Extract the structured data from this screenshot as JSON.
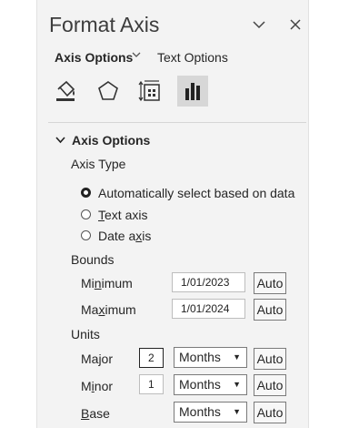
{
  "header": {
    "title": "Format Axis",
    "collapse_icon": "chevron-down-icon",
    "close_icon": "close-icon"
  },
  "tabs": {
    "axis_options": "Axis Options",
    "text_options": "Text Options"
  },
  "toolbar_icons": [
    "fill-line-icon",
    "effects-pentagon-icon",
    "size-properties-icon",
    "axis-options-chart-icon"
  ],
  "section": {
    "title": "Axis Options",
    "axis_type": {
      "label": "Axis Type",
      "options": [
        {
          "pre": "Automatically",
          "u": "",
          "post": " select based on data",
          "selected": true
        },
        {
          "pre": "",
          "u": "T",
          "post": "ext axis",
          "selected": false
        },
        {
          "pre": "Date a",
          "u": "x",
          "post": "is",
          "selected": false
        }
      ]
    },
    "bounds": {
      "label": "Bounds",
      "minimum": {
        "pre": "Mi",
        "u": "n",
        "post": "imum",
        "value": "1/01/2023",
        "button": "Auto"
      },
      "maximum": {
        "pre": "Ma",
        "u": "x",
        "post": "imum",
        "value": "1/01/2024",
        "button": "Auto"
      }
    },
    "units": {
      "label": "Units",
      "major": {
        "pre": "Major",
        "u": "",
        "post": "",
        "value": "2",
        "unit": "Months",
        "button": "Auto"
      },
      "minor": {
        "pre": "M",
        "u": "i",
        "post": "nor",
        "value": "1",
        "unit": "Months",
        "button": "Auto"
      },
      "base": {
        "pre": "",
        "u": "B",
        "post": "ase",
        "unit": "Months",
        "button": "Auto"
      }
    }
  }
}
